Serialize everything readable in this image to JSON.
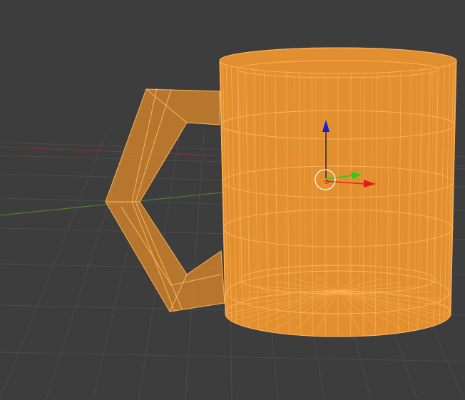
{
  "viewport": {
    "object": "mug",
    "mode": "edit-wireframe",
    "colors": {
      "background": "#3d3d3d",
      "grid": "#4a4a4a",
      "mesh_fill": "#f0962e",
      "mesh_wire": "#ffb45a",
      "axis_x": "#c03030",
      "axis_y": "#5a9a30",
      "gizmo_x": "#e02020",
      "gizmo_y": "#20d020",
      "gizmo_z": "#2020e0"
    }
  }
}
